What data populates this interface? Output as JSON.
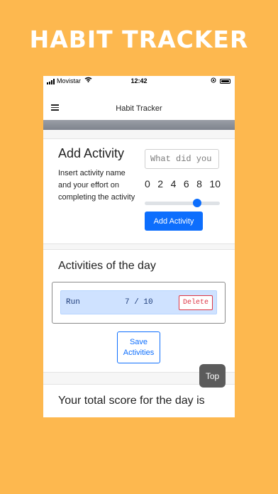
{
  "promo": {
    "title": "HABIT TRACKER"
  },
  "status_bar": {
    "carrier": "Movistar",
    "time": "12:42"
  },
  "header": {
    "title": "Habit Tracker"
  },
  "add_activity": {
    "heading": "Add Activity",
    "description": "Insert activity name and your effort on completing the activity",
    "input_placeholder": "What did you",
    "slider_ticks": [
      "0",
      "2",
      "4",
      "6",
      "8",
      "10"
    ],
    "slider_value": 7,
    "slider_max": 10,
    "button_label": "Add Activity"
  },
  "activities": {
    "heading": "Activities of the day",
    "items": [
      {
        "name": "Run",
        "score": "7 / 10",
        "delete_label": "Delete"
      }
    ],
    "save_label": "Save Activities"
  },
  "score": {
    "heading": "Your total score for the day is"
  },
  "scroll_top": {
    "label": "Top"
  },
  "colors": {
    "background": "#fdb84f",
    "primary": "#0d6efd",
    "danger": "#dc3545",
    "row_bg": "#cfe2ff"
  }
}
